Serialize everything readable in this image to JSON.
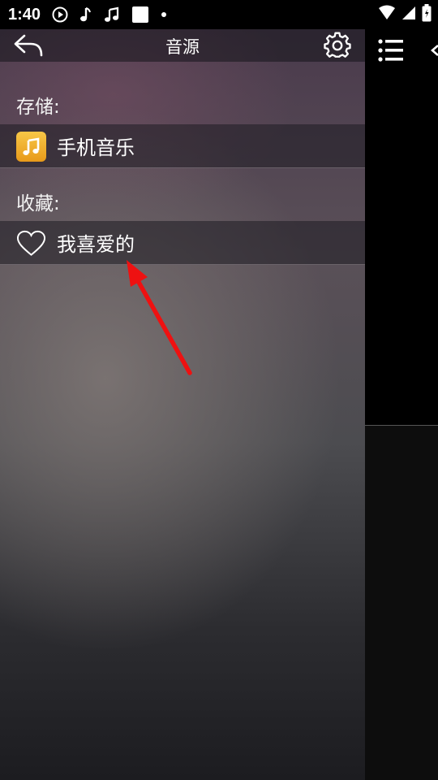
{
  "status_bar": {
    "time": "1:40",
    "icons": [
      "play-circle-icon",
      "music-note-icon",
      "music-notes-icon",
      "square-icon",
      "dot-icon",
      "wifi-icon",
      "signal-icon",
      "battery-icon"
    ]
  },
  "drawer": {
    "title": "音源",
    "sections": [
      {
        "label": "存储:",
        "items": [
          {
            "label": "手机音乐",
            "icon": "music-note-icon"
          }
        ]
      },
      {
        "label": "收藏:",
        "items": [
          {
            "label": "我喜爱的",
            "icon": "heart-icon"
          }
        ]
      }
    ]
  },
  "right_panel": {
    "icons": [
      "list-icon",
      "back-arrow-icon"
    ]
  },
  "colors": {
    "music_tile": "#f2b52e",
    "annotation": "#ee1111"
  }
}
